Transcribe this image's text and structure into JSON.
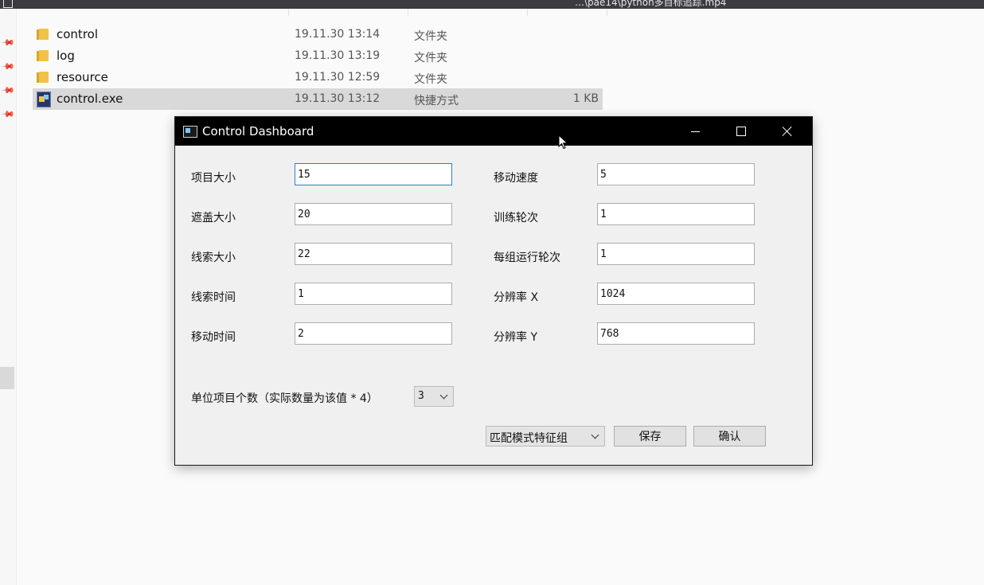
{
  "explorer": {
    "window_title": "…\\pae14\\python多目标追踪.mp4",
    "files": [
      {
        "name": "control",
        "date": "19.11.30 13:14",
        "type": "文件夹",
        "size": "",
        "icon": "folder-icon"
      },
      {
        "name": "log",
        "date": "19.11.30 13:19",
        "type": "文件夹",
        "size": "",
        "icon": "folder-icon"
      },
      {
        "name": "resource",
        "date": "19.11.30 12:59",
        "type": "文件夹",
        "size": "",
        "icon": "folder-icon"
      },
      {
        "name": "control.exe",
        "date": "19.11.30 13:12",
        "type": "快捷方式",
        "size": "1 KB",
        "icon": "exe-icon"
      }
    ]
  },
  "dialog": {
    "title": "Control Dashboard",
    "fields_left": [
      {
        "label": "项目大小",
        "value": "15"
      },
      {
        "label": "遮盖大小",
        "value": "20"
      },
      {
        "label": "线索大小",
        "value": "22"
      },
      {
        "label": "线索时间",
        "value": "1"
      },
      {
        "label": "移动时间",
        "value": "2"
      }
    ],
    "fields_right": [
      {
        "label": "移动速度",
        "value": "5"
      },
      {
        "label": "训练轮次",
        "value": "1"
      },
      {
        "label": "每组运行轮次",
        "value": "1"
      },
      {
        "label": "分辨率 X",
        "value": "1024"
      },
      {
        "label": "分辨率 Y",
        "value": "768"
      }
    ],
    "unit_count": {
      "label": "单位项目个数（实际数量为该值 * 4）",
      "value": "3"
    },
    "mode_select": {
      "value": "匹配模式特征组"
    },
    "save_label": "保存",
    "confirm_label": "确认"
  },
  "colors": {
    "titlebar": "#000000",
    "focus_border": "#2f7bcd",
    "selected_row": "#d9d9d9"
  }
}
